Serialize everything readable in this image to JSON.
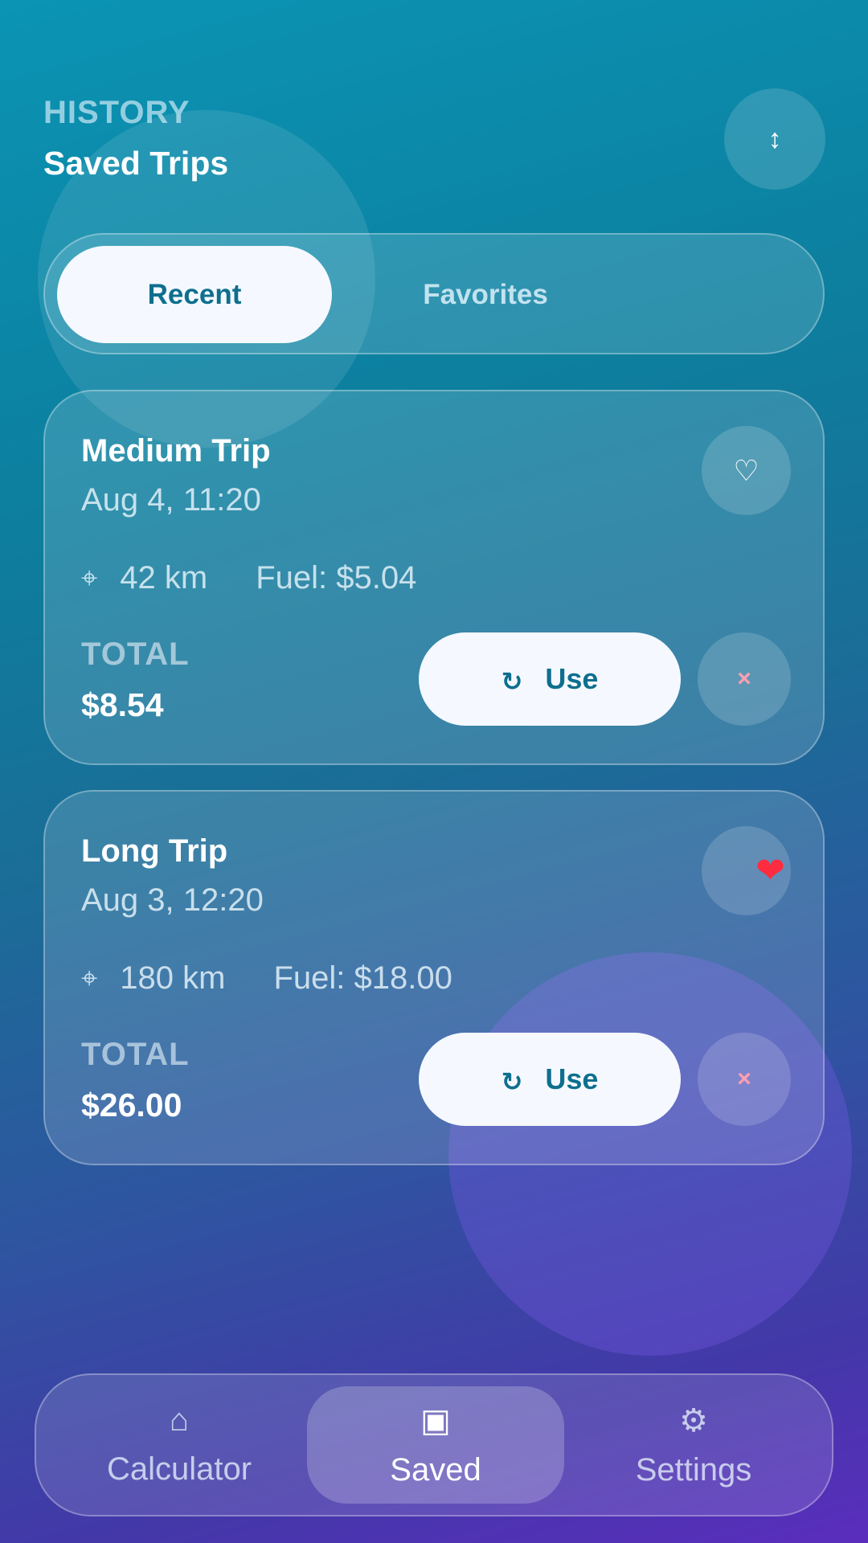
{
  "header": {
    "eyebrow": "HISTORY",
    "title": "Saved Trips",
    "sort_icon": "↕"
  },
  "segmented": {
    "tabs": [
      {
        "label": "Recent",
        "active": true
      },
      {
        "label": "Favorites",
        "active": false
      }
    ]
  },
  "trips": [
    {
      "title": "Medium Trip",
      "date": "Aug 4, 11:20",
      "distance": "42 km",
      "fuel": "Fuel: $5.04",
      "total_label": "TOTAL",
      "total": "$8.54",
      "favorite": false,
      "fav_icon": "♡",
      "use_label": "Use",
      "use_icon": "↻",
      "delete_icon": "×",
      "distance_icon": "⌖"
    },
    {
      "title": "Long Trip",
      "date": "Aug 3, 12:20",
      "distance": "180 km",
      "fuel": "Fuel: $18.00",
      "total_label": "TOTAL",
      "total": "$26.00",
      "favorite": true,
      "fav_icon": "❤",
      "use_label": "Use",
      "use_icon": "↻",
      "delete_icon": "×",
      "distance_icon": "⌖"
    }
  ],
  "nav": {
    "items": [
      {
        "label": "Calculator",
        "icon": "⌂",
        "active": false
      },
      {
        "label": "Saved",
        "icon": "▣",
        "active": true
      },
      {
        "label": "Settings",
        "icon": "⚙",
        "active": false
      }
    ]
  },
  "colors": {
    "accent": "#0e6f8e",
    "favorite_red": "#ff2b3f",
    "delete_pink": "#ff9fb0",
    "button_bg": "#f5f9ff"
  }
}
